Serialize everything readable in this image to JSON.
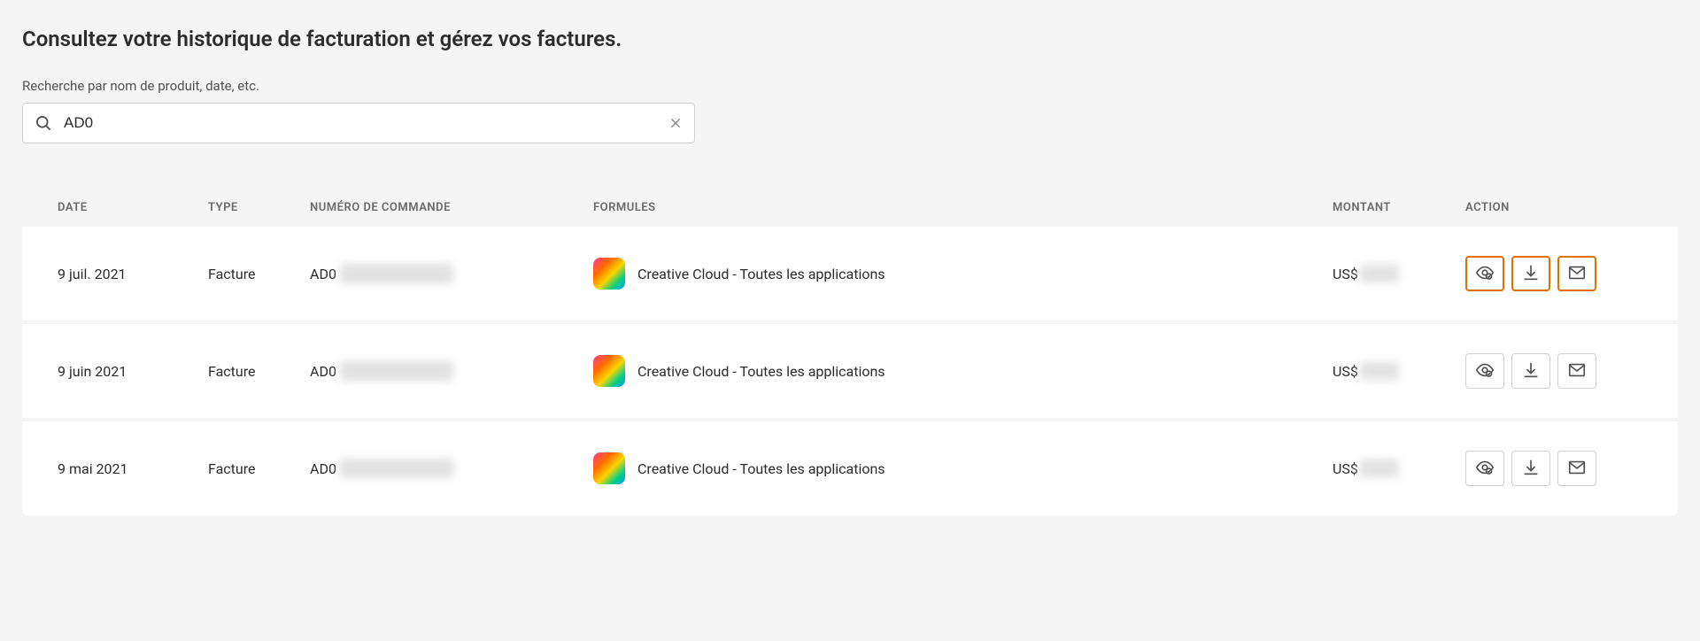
{
  "page": {
    "title": "Consultez votre historique de facturation et gérez vos factures.",
    "search_label": "Recherche par nom de produit, date, etc.",
    "search_value": "AD0"
  },
  "table": {
    "headers": {
      "date": "DATE",
      "type": "TYPE",
      "order": "NUMÉRO DE COMMANDE",
      "plans": "FORMULES",
      "amount": "MONTANT",
      "action": "ACTION"
    },
    "rows": [
      {
        "date": "9 juil. 2021",
        "type": "Facture",
        "order_prefix": "AD0",
        "plan": "Creative Cloud - Toutes les applications",
        "amount_prefix": "US$",
        "highlighted": true
      },
      {
        "date": "9 juin 2021",
        "type": "Facture",
        "order_prefix": "AD0",
        "plan": "Creative Cloud - Toutes les applications",
        "amount_prefix": "US$",
        "highlighted": false
      },
      {
        "date": "9 mai 2021",
        "type": "Facture",
        "order_prefix": "AD0",
        "plan": "Creative Cloud - Toutes les applications",
        "amount_prefix": "US$",
        "highlighted": false
      }
    ]
  }
}
